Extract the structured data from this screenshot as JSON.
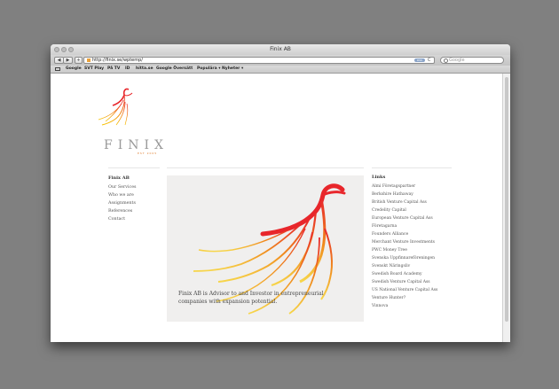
{
  "window": {
    "title": "Finix AB"
  },
  "toolbar": {
    "back_glyph": "◀",
    "forward_glyph": "▶",
    "add_glyph": "+",
    "url": "http://finix.se/wptemp/",
    "rss_label": "RSS",
    "reload_glyph": "C",
    "search_placeholder": "Google"
  },
  "bookmarks": [
    "Google",
    "SVT Play",
    "På TV",
    "ID",
    "hitta.se",
    "Google Översätt",
    "Populära ▾",
    "Nyheter ▾"
  ],
  "logo": {
    "word": "FINIX",
    "sub": "EST 2005"
  },
  "nav": {
    "title": "Finix AB",
    "items": [
      "Our Services",
      "Who we are",
      "Assignments",
      "References",
      "Contact"
    ]
  },
  "hero": {
    "text": "Finix AB is Advisor to and Investor in entrepreneurial companies with expansion potential."
  },
  "links": {
    "title": "Links",
    "items": [
      "Almi Företagspartner",
      "Berkshire Hathaway",
      "British Venture Capital Ass",
      "Credelity Capital",
      "European Venture Capital Ass",
      "Företagarna",
      "Founders Alliance",
      "Merchant Venture Investments",
      "PWC Money Tree",
      "Svenska Uppfinnareföreningen",
      "Svenskt Näringsliv",
      "Swedish Board Academy",
      "Swedish Venture Capital Ass",
      "US National Venture Capital Ass",
      "Venture Hunter?",
      "Vinnova"
    ]
  },
  "colors": {
    "background": "#808080",
    "accent_red": "#e8262b",
    "accent_yellow": "#f7c400"
  }
}
